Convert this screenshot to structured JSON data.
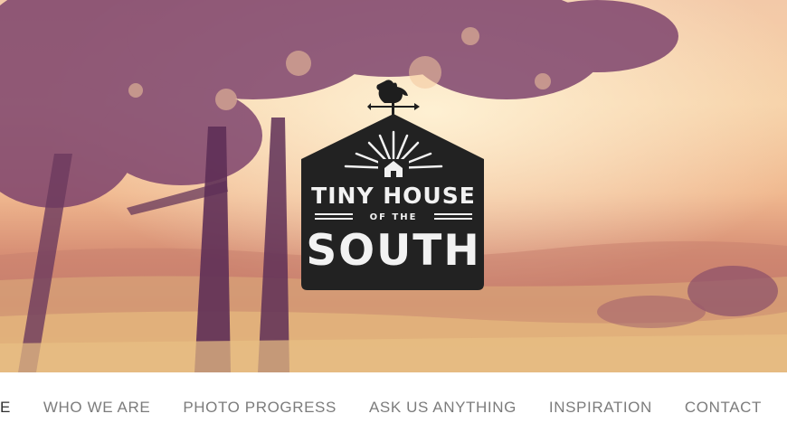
{
  "logo": {
    "line1": "TINY HOUSE",
    "line2": "OF THE",
    "line3": "SOUTH"
  },
  "nav": {
    "items": [
      {
        "label": "HOME",
        "active": true
      },
      {
        "label": "WHO WE ARE",
        "active": false
      },
      {
        "label": "PHOTO PROGRESS",
        "active": false
      },
      {
        "label": "ASK US ANYTHING",
        "active": false
      },
      {
        "label": "INSPIRATION",
        "active": false
      },
      {
        "label": "CONTACT",
        "active": false
      }
    ]
  },
  "colors": {
    "nav_active": "#2f2f2f",
    "nav_inactive": "#7c7c7c",
    "logo_bg": "#222222",
    "logo_text": "#f2f2f2"
  }
}
